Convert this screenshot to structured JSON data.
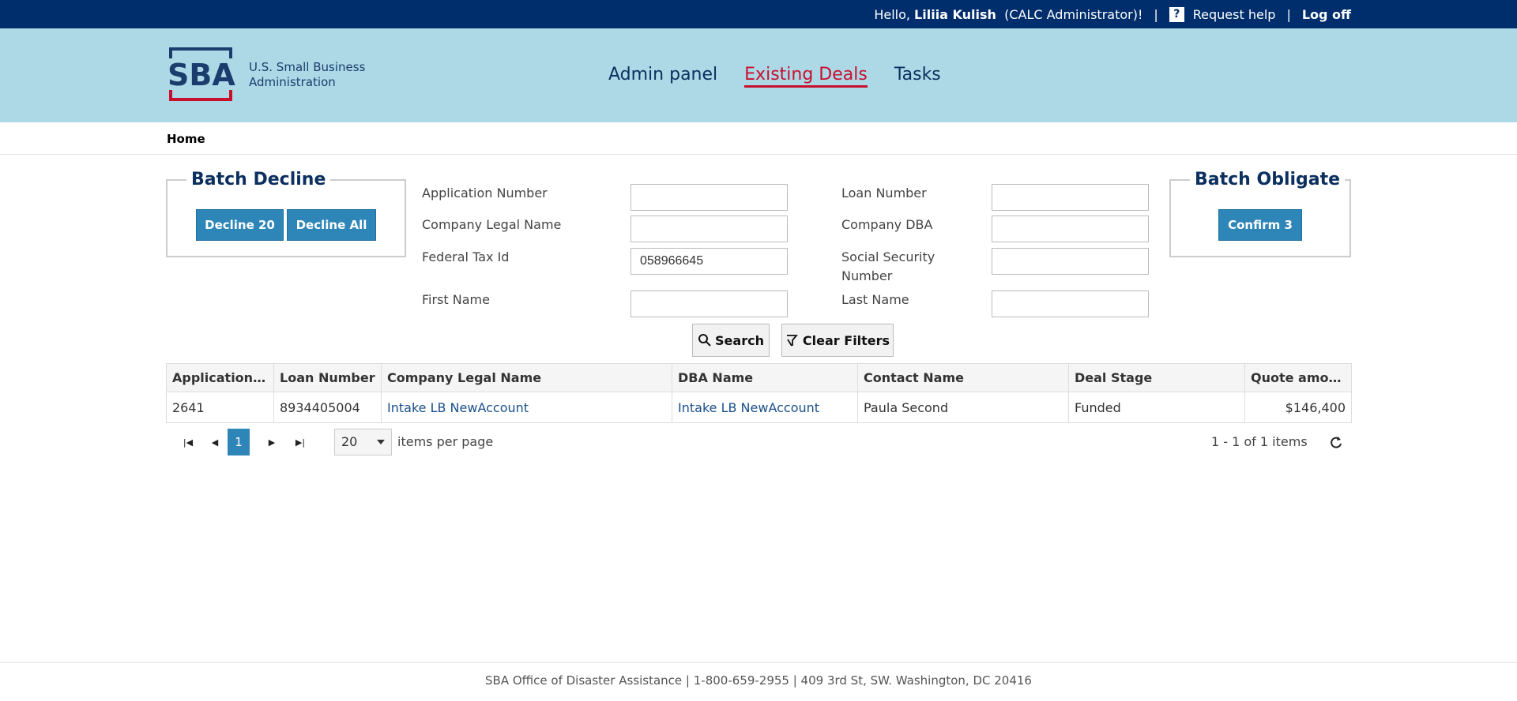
{
  "topbar": {
    "greeting": "Hello,",
    "user_name": "Liliia Kulish",
    "role": "(CALC Administrator)!",
    "separator": "|",
    "help_glyph": "?",
    "request_help": "Request help",
    "logoff": "Log off"
  },
  "header": {
    "logo_letters": "SBA",
    "logo_line1": "U.S. Small Business",
    "logo_line2": "Administration",
    "nav": [
      "Admin panel",
      "Existing Deals",
      "Tasks"
    ],
    "active_nav": "Existing Deals"
  },
  "breadcrumb": "Home",
  "batch_decline": {
    "title": "Batch Decline",
    "decline20": "Decline 20",
    "decline_all": "Decline All"
  },
  "batch_obligate": {
    "title": "Batch Obligate",
    "confirm": "Confirm 3"
  },
  "filters": {
    "application_number": {
      "label": "Application Number",
      "value": ""
    },
    "loan_number": {
      "label": "Loan Number",
      "value": ""
    },
    "company_legal_name": {
      "label": "Company Legal Name",
      "value": ""
    },
    "company_dba": {
      "label": "Company DBA",
      "value": ""
    },
    "federal_tax_id": {
      "label": "Federal Tax Id",
      "value": "058966645"
    },
    "ssn": {
      "label_line1": "Social Security",
      "label_line2": "Number",
      "value": ""
    },
    "first_name": {
      "label": "First Name",
      "value": ""
    },
    "last_name": {
      "label": "Last Name",
      "value": ""
    }
  },
  "actions": {
    "search": "Search",
    "clear": "Clear Filters"
  },
  "table": {
    "columns": [
      "Application ...",
      "Loan Number",
      "Company Legal Name",
      "DBA Name",
      "Contact Name",
      "Deal Stage",
      "Quote amount"
    ],
    "rows": [
      [
        "2641",
        "8934405004",
        "Intake LB NewAccount",
        "Intake LB NewAccount",
        "Paula Second",
        "Funded",
        "$146,400"
      ]
    ]
  },
  "pager": {
    "current_page": "1",
    "page_size": "20",
    "per_page_label": "items per page",
    "summary": "1 - 1 of 1 items"
  },
  "footer": "SBA Office of Disaster Assistance | 1-800-659-2955 | 409 3rd St, SW. Washington, DC 20416",
  "colors": {
    "topbar": "#002e6d",
    "header": "#add8e6",
    "accent_red": "#c8102e",
    "button_blue": "#2e86b8"
  }
}
